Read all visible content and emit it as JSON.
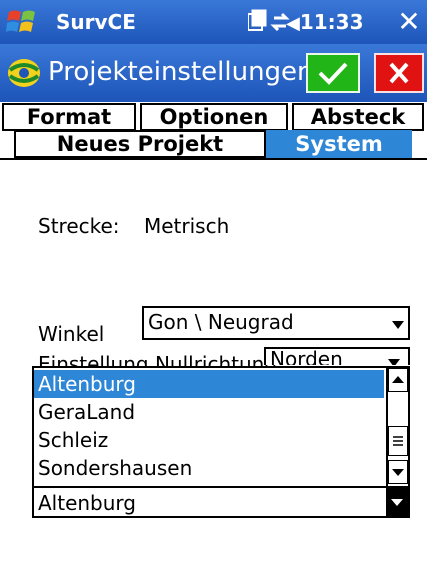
{
  "statusbar": {
    "app_name": "SurvCE",
    "time": "11:33",
    "icons": [
      "connectivity-icon",
      "sync-icon",
      "volume-icon"
    ],
    "close_glyph": "✕"
  },
  "header": {
    "title": "Projekteinstellungen",
    "ok_glyph": "✓",
    "cancel_glyph": "✕"
  },
  "tabs": {
    "row1": [
      "Format",
      "Optionen",
      "Absteck"
    ],
    "row2": [
      "Neues Projekt",
      "System"
    ],
    "active": "System"
  },
  "content": {
    "strecke_label": "Strecke:",
    "strecke_value": "Metrisch",
    "winkel_label": "Winkel",
    "winkel_value": "Gon \\ Neugrad",
    "hidden_label_partial": "Einstellung Nullrichtung",
    "nullrichtung_value": "Norden"
  },
  "dropdown": {
    "items": [
      "Altenburg",
      "GeraLand",
      "Schleiz",
      "Sondershausen"
    ],
    "selected": "Altenburg",
    "current_value": "Altenburg"
  },
  "colors": {
    "titlebar": "#1d55b8",
    "accent": "#2e86d6",
    "ok_green": "#22b518",
    "cancel_red": "#e01212"
  }
}
